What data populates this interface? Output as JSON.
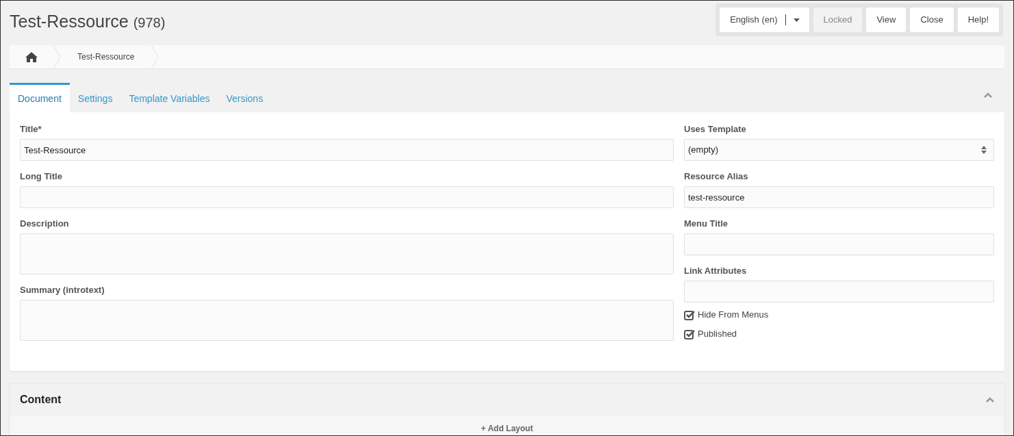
{
  "header": {
    "title": "Test-Ressource",
    "id": "(978)"
  },
  "toolbar": [
    {
      "kind": "dropdown",
      "label": "English (en)",
      "disabled": false
    },
    {
      "kind": "button",
      "label": "Locked",
      "disabled": true
    },
    {
      "kind": "button",
      "label": "View",
      "disabled": false
    },
    {
      "kind": "button",
      "label": "Close",
      "disabled": false
    },
    {
      "kind": "button",
      "label": "Help!",
      "disabled": false
    }
  ],
  "breadcrumb": [
    {
      "kind": "home"
    },
    {
      "kind": "link",
      "label": "Test-Ressource"
    }
  ],
  "tabs": [
    {
      "label": "Document",
      "selected": true
    },
    {
      "label": "Settings",
      "selected": false
    },
    {
      "label": "Template Variables",
      "selected": false
    },
    {
      "label": "Versions",
      "selected": false
    }
  ],
  "left_fields": [
    {
      "kind": "input",
      "label": "Title*",
      "value": "Test-Ressource"
    },
    {
      "kind": "input",
      "label": "Long Title"
    },
    {
      "kind": "textarea",
      "label": "Description"
    },
    {
      "kind": "textarea",
      "label": "Summary (introtext)"
    }
  ],
  "right_fields": [
    {
      "kind": "select",
      "label": "Uses Template",
      "value": "(empty)"
    },
    {
      "kind": "input",
      "label": "Resource Alias",
      "value": "test-ressource"
    },
    {
      "kind": "input",
      "label": "Menu Title"
    },
    {
      "kind": "input",
      "label": "Link Attributes"
    }
  ],
  "checkboxes": [
    {
      "label": "Hide From Menus",
      "checked": true
    },
    {
      "label": "Published",
      "checked": true
    }
  ],
  "content": {
    "title": "Content",
    "add_label": "+ Add Layout"
  }
}
